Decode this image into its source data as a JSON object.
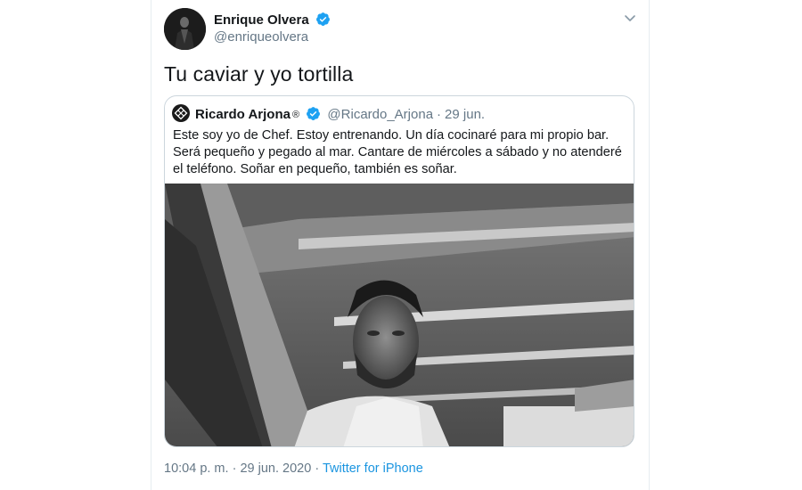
{
  "tweet": {
    "author_name": "Enrique Olvera",
    "author_handle": "@enriqueolvera",
    "text": "Tu caviar y yo tortilla",
    "time": "10:04 p. m.",
    "date": "29 jun. 2020",
    "source": "Twitter for iPhone",
    "separator": "·"
  },
  "quoted": {
    "author_name": "Ricardo Arjona",
    "registered_mark": "®",
    "author_handle": "@Ricardo_Arjona",
    "separator": "·",
    "date": "29 jun.",
    "lines": [
      "Este soy yo de Chef. Estoy entrenando. Un día cocinaré para mi propio bar.",
      "Será pequeño y pegado al mar. Cantare de miércoles a sábado y no atenderé",
      "el teléfono.  Soñar en pequeño,  también es soñar."
    ]
  },
  "colors": {
    "verified": "#1da1f2",
    "link": "#1b95e0",
    "secondary_text": "#657786",
    "border": "#ccd6dd"
  },
  "icons": {
    "verified": "verified-badge-icon",
    "menu": "chevron-down-icon"
  }
}
